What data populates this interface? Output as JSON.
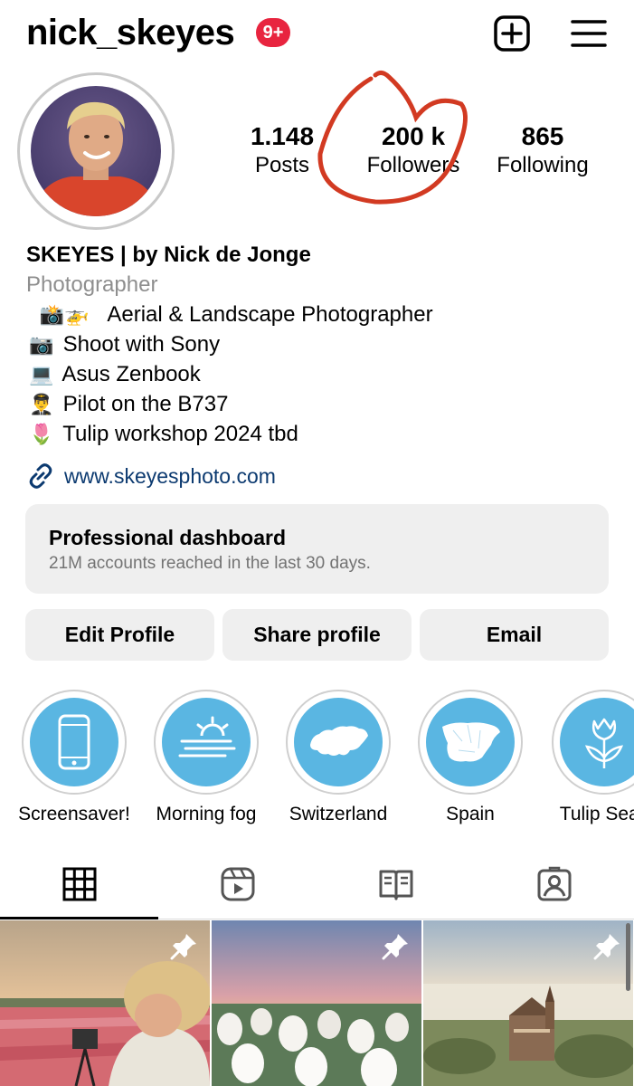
{
  "header": {
    "username": "nick_skeyes",
    "notification_badge": "9+",
    "badge_color": "#e8243f",
    "icons": [
      "add-post-icon",
      "menu-icon"
    ]
  },
  "stats": {
    "posts": {
      "value": "1.148",
      "label": "Posts"
    },
    "followers": {
      "value": "200 k",
      "label": "Followers"
    },
    "following": {
      "value": "865",
      "label": "Following"
    }
  },
  "annotation_color": "#d23a22",
  "bio": {
    "name": "SKEYES | by Nick de Jonge",
    "category": "Photographer",
    "lines": [
      {
        "emoji": "📸🚁",
        "text": "Aerial & Landscape Photographer"
      },
      {
        "emoji": "📷",
        "text": "Shoot with Sony"
      },
      {
        "emoji": "💻",
        "text": "Asus Zenbook"
      },
      {
        "emoji": "👨‍✈️",
        "text": "Pilot on the B737"
      },
      {
        "emoji": "🌷",
        "text": "Tulip workshop 2024 tbd"
      }
    ],
    "link": "www.skeyesphoto.com"
  },
  "dashboard": {
    "title": "Professional dashboard",
    "subtitle": "21M accounts reached in the last 30 days."
  },
  "buttons": {
    "edit": "Edit Profile",
    "share": "Share profile",
    "email": "Email"
  },
  "highlights": [
    {
      "label": "Screensaver!",
      "icon": "phone-icon"
    },
    {
      "label": "Morning fog",
      "icon": "fog-icon"
    },
    {
      "label": "Switzerland",
      "icon": "switzerland-map-icon"
    },
    {
      "label": "Spain",
      "icon": "spain-map-icon"
    },
    {
      "label": "Tulip Seas",
      "icon": "tulip-icon"
    }
  ],
  "highlight_color": "#5ab6e2",
  "tabs": [
    "grid-icon",
    "reels-icon",
    "guides-icon",
    "tagged-icon"
  ],
  "posts": [
    {
      "pinned": true,
      "subject": "tulip-field-photographer"
    },
    {
      "pinned": true,
      "subject": "white-tulips-sunrise"
    },
    {
      "pinned": true,
      "subject": "castle-in-fog"
    }
  ]
}
